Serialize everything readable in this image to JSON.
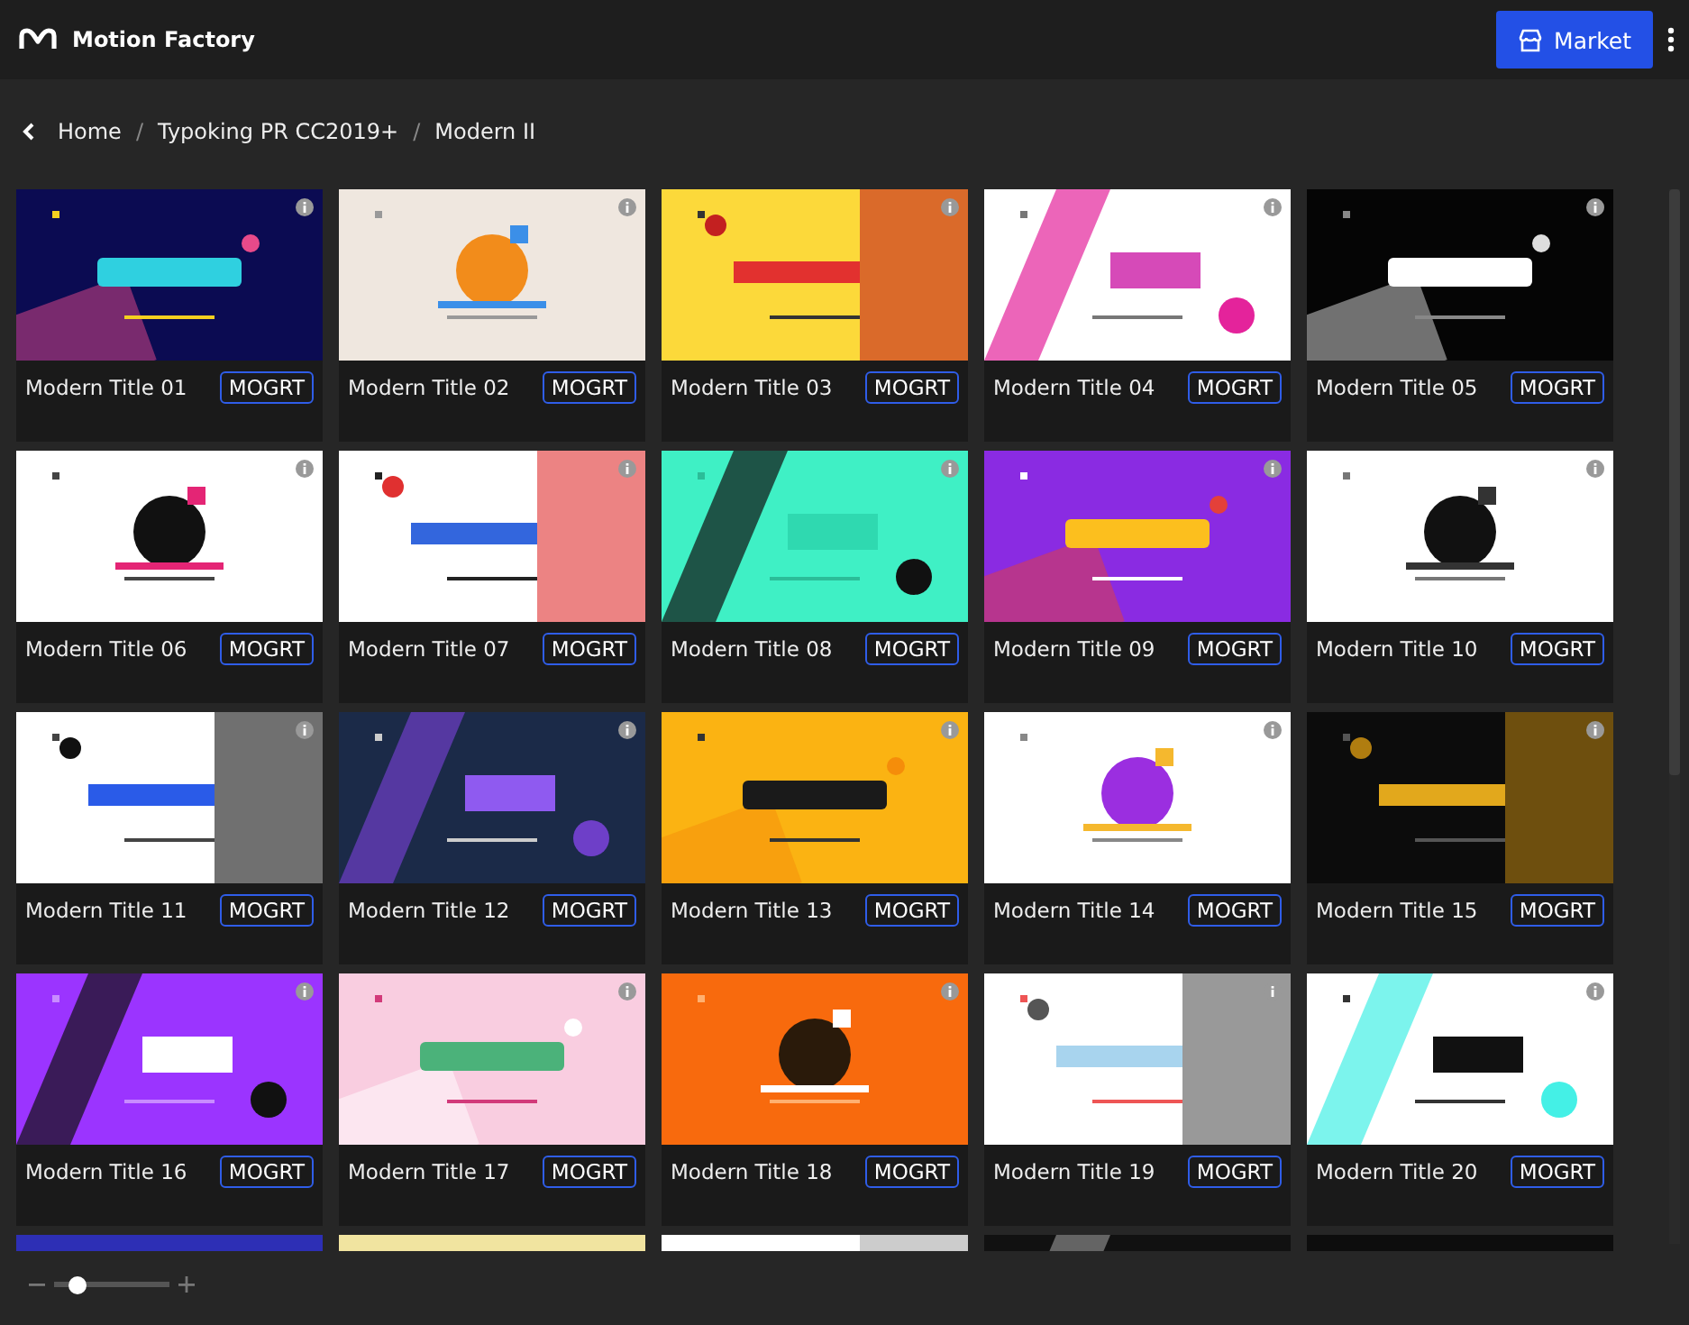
{
  "app": {
    "title": "Motion Factory"
  },
  "market_button": {
    "label": "Market"
  },
  "breadcrumb": [
    {
      "label": "Home"
    },
    {
      "label": "Typoking PR CC2019+"
    },
    {
      "label": "Modern II"
    }
  ],
  "breadcrumb_separators": [
    "/",
    "/"
  ],
  "cards": [
    {
      "title": "Modern Title 01",
      "tag": "MOGRT"
    },
    {
      "title": "Modern Title 02",
      "tag": "MOGRT"
    },
    {
      "title": "Modern Title 03",
      "tag": "MOGRT"
    },
    {
      "title": "Modern Title 04",
      "tag": "MOGRT"
    },
    {
      "title": "Modern Title 05",
      "tag": "MOGRT"
    },
    {
      "title": "Modern Title 06",
      "tag": "MOGRT"
    },
    {
      "title": "Modern Title 07",
      "tag": "MOGRT"
    },
    {
      "title": "Modern Title 08",
      "tag": "MOGRT"
    },
    {
      "title": "Modern Title 09",
      "tag": "MOGRT"
    },
    {
      "title": "Modern Title 10",
      "tag": "MOGRT"
    },
    {
      "title": "Modern Title 11",
      "tag": "MOGRT"
    },
    {
      "title": "Modern Title 12",
      "tag": "MOGRT"
    },
    {
      "title": "Modern Title 13",
      "tag": "MOGRT"
    },
    {
      "title": "Modern Title 14",
      "tag": "MOGRT"
    },
    {
      "title": "Modern Title 15",
      "tag": "MOGRT"
    },
    {
      "title": "Modern Title 16",
      "tag": "MOGRT"
    },
    {
      "title": "Modern Title 17",
      "tag": "MOGRT"
    },
    {
      "title": "Modern Title 18",
      "tag": "MOGRT"
    },
    {
      "title": "Modern Title 19",
      "tag": "MOGRT"
    },
    {
      "title": "Modern Title 20",
      "tag": "MOGRT"
    }
  ],
  "partial_row": [
    {
      "kind": "picture"
    },
    {
      "kind": "picture"
    },
    {
      "kind": "picture"
    },
    {
      "kind": "picture"
    },
    {
      "kind": "picture"
    }
  ],
  "zoom_slider": {
    "level": 0.2
  }
}
